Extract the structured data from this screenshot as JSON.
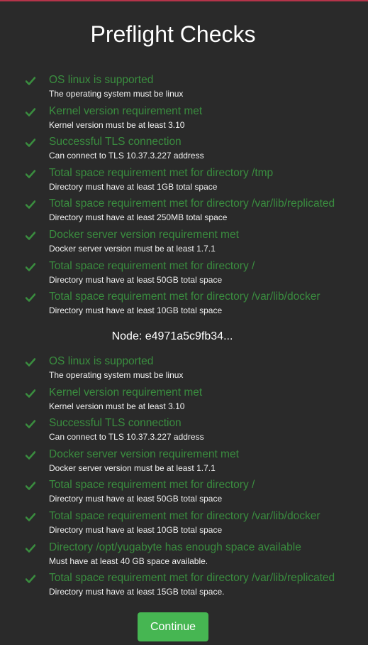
{
  "title": "Preflight Checks",
  "colors": {
    "success": "#3a8d3f",
    "button": "#46b652",
    "background": "#2a2a2a",
    "accent_bar": "#b5344a"
  },
  "check_icon": "checkmark-icon",
  "group1": {
    "checks": [
      {
        "title": "OS linux is supported",
        "desc": "The operating system must be linux"
      },
      {
        "title": "Kernel version requirement met",
        "desc": "Kernel version must be at least 3.10"
      },
      {
        "title": "Successful TLS connection",
        "desc": "Can connect to TLS 10.37.3.227 address"
      },
      {
        "title": "Total space requirement met for directory /tmp",
        "desc": "Directory must have at least 1GB total space"
      },
      {
        "title": "Total space requirement met for directory /var/lib/replicated",
        "desc": "Directory must have at least 250MB total space"
      },
      {
        "title": "Docker server version requirement met",
        "desc": "Docker server version must be at least 1.7.1"
      },
      {
        "title": "Total space requirement met for directory /",
        "desc": "Directory must have at least 50GB total space"
      },
      {
        "title": "Total space requirement met for directory /var/lib/docker",
        "desc": "Directory must have at least 10GB total space"
      }
    ]
  },
  "node_label": "Node: e4971a5c9fb34...",
  "group2": {
    "checks": [
      {
        "title": "OS linux is supported",
        "desc": "The operating system must be linux"
      },
      {
        "title": "Kernel version requirement met",
        "desc": "Kernel version must be at least 3.10"
      },
      {
        "title": "Successful TLS connection",
        "desc": "Can connect to TLS 10.37.3.227 address"
      },
      {
        "title": "Docker server version requirement met",
        "desc": "Docker server version must be at least 1.7.1"
      },
      {
        "title": "Total space requirement met for directory /",
        "desc": "Directory must have at least 50GB total space"
      },
      {
        "title": "Total space requirement met for directory /var/lib/docker",
        "desc": "Directory must have at least 10GB total space"
      },
      {
        "title": "Directory /opt/yugabyte has enough space available",
        "desc": "Must have at least 40 GB space available."
      },
      {
        "title": "Total space requirement met for directory /var/lib/replicated",
        "desc": "Directory must have at least 15GB total space."
      }
    ]
  },
  "continue_label": "Continue"
}
